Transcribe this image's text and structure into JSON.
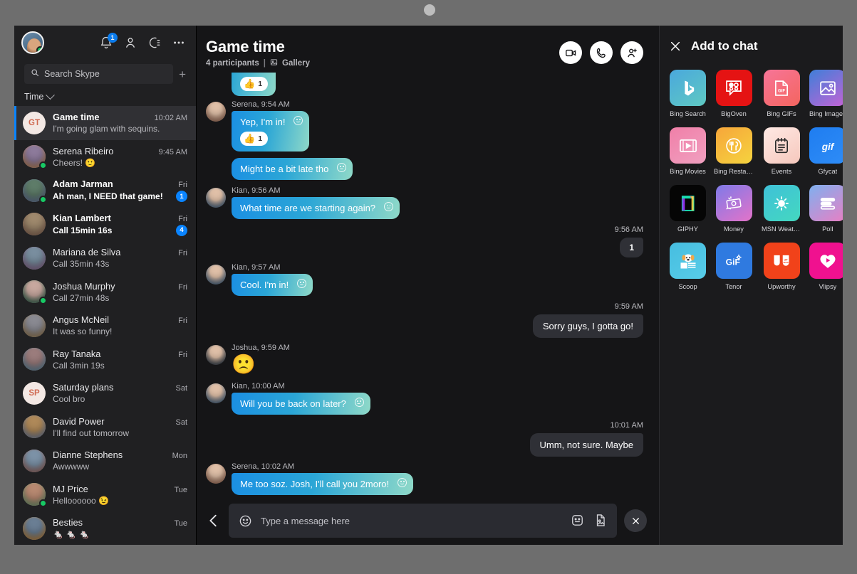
{
  "window": {
    "notch": "camera-dot"
  },
  "sidebar": {
    "profile": {
      "name": "my-avatar",
      "status": "online"
    },
    "header_icons": [
      {
        "name": "notifications-bell-icon",
        "badge": "1"
      },
      {
        "name": "contacts-person-icon",
        "badge": ""
      },
      {
        "name": "status-moon-icon",
        "badge": ""
      },
      {
        "name": "more-options-icon",
        "badge": ""
      }
    ],
    "search": {
      "placeholder": "Search Skype",
      "value": "",
      "new_chat": "+"
    },
    "filter": {
      "label": "Time"
    },
    "chats": [
      {
        "name": "Game time",
        "preview": "I'm going glam with sequins.",
        "time": "10:02 AM",
        "badge": "",
        "initials": "GT",
        "active": true,
        "bold_name": true,
        "presence": false
      },
      {
        "name": "Serena Ribeiro",
        "preview": "Cheers! 🙂",
        "time": "9:45 AM",
        "badge": "",
        "initials": "",
        "active": false,
        "bold_name": false,
        "presence": true
      },
      {
        "name": "Adam Jarman",
        "preview": "Ah man, I NEED that game!",
        "time": "Fri",
        "badge": "1",
        "initials": "",
        "active": false,
        "bold_name": true,
        "presence": true
      },
      {
        "name": "Kian Lambert",
        "preview": "Call 15min 16s",
        "time": "Fri",
        "badge": "4",
        "initials": "",
        "active": false,
        "bold_name": true,
        "presence": false
      },
      {
        "name": "Mariana de Silva",
        "preview": "Call 35min 43s",
        "time": "Fri",
        "badge": "",
        "initials": "",
        "active": false,
        "bold_name": false,
        "presence": false
      },
      {
        "name": "Joshua Murphy",
        "preview": "Call 27min 48s",
        "time": "Fri",
        "badge": "",
        "initials": "",
        "active": false,
        "bold_name": false,
        "presence": true
      },
      {
        "name": "Angus McNeil",
        "preview": "It was so funny!",
        "time": "Fri",
        "badge": "",
        "initials": "",
        "active": false,
        "bold_name": false,
        "presence": false
      },
      {
        "name": "Ray Tanaka",
        "preview": "Call 3min 19s",
        "time": "Fri",
        "badge": "",
        "initials": "",
        "active": false,
        "bold_name": false,
        "presence": false
      },
      {
        "name": "Saturday plans",
        "preview": "Cool bro",
        "time": "Sat",
        "badge": "",
        "initials": "SP",
        "active": false,
        "bold_name": false,
        "presence": false
      },
      {
        "name": "David Power",
        "preview": "I'll find out tomorrow",
        "time": "Sat",
        "badge": "",
        "initials": "",
        "active": false,
        "bold_name": false,
        "presence": false
      },
      {
        "name": "Dianne Stephens",
        "preview": "Awwwww",
        "time": "Mon",
        "badge": "",
        "initials": "",
        "active": false,
        "bold_name": false,
        "presence": false
      },
      {
        "name": "MJ Price",
        "preview": "Helloooooo 😉",
        "time": "Tue",
        "badge": "",
        "initials": "",
        "active": false,
        "bold_name": false,
        "presence": true
      },
      {
        "name": "Besties",
        "preview": "🐁 🐁 🐁",
        "time": "Tue",
        "badge": "",
        "initials": "",
        "active": false,
        "bold_name": false,
        "presence": false
      }
    ]
  },
  "chat": {
    "title": "Game time",
    "participants": "4 participants",
    "separator": "|",
    "gallery": "Gallery",
    "actions": [
      {
        "name": "video-call-button"
      },
      {
        "name": "audio-call-button"
      },
      {
        "name": "add-people-button"
      }
    ],
    "messages": [
      {
        "id": "m0",
        "type": "partial-top",
        "reaction_emoji": "👍",
        "reaction_count": "1"
      },
      {
        "id": "m1",
        "type": "in",
        "meta": "Serena, 9:54 AM",
        "text": "Yep, I'm in!",
        "reaction_emoji": "👍",
        "reaction_count": "1"
      },
      {
        "id": "m2",
        "type": "in-cont",
        "meta": "",
        "text": "Might be a bit late tho",
        "reaction_emoji": "",
        "reaction_count": ""
      },
      {
        "id": "m3",
        "type": "in",
        "meta": "Kian, 9:56 AM",
        "text": "What time are we starting again?",
        "reaction_emoji": "",
        "reaction_count": ""
      },
      {
        "id": "m4",
        "type": "out",
        "time": "9:56 AM",
        "text": "1"
      },
      {
        "id": "m5",
        "type": "in",
        "meta": "Kian, 9:57 AM",
        "text": "Cool. I'm in!",
        "reaction_emoji": "",
        "reaction_count": ""
      },
      {
        "id": "m6",
        "type": "out",
        "time": "9:59 AM",
        "text": "Sorry guys, I gotta go!"
      },
      {
        "id": "m7",
        "type": "in-emoji",
        "meta": "Joshua, 9:59 AM",
        "text": "🙁"
      },
      {
        "id": "m8",
        "type": "in",
        "meta": "Kian, 10:00 AM",
        "text": "Will you be back on later?",
        "reaction_emoji": "",
        "reaction_count": ""
      },
      {
        "id": "m9",
        "type": "out",
        "time": "10:01 AM",
        "text": "Umm, not sure. Maybe"
      },
      {
        "id": "m10",
        "type": "in",
        "meta": "Serena, 10:02 AM",
        "text": "Me too soz. Josh, I'll call you 2moro!",
        "reaction_emoji": "",
        "reaction_count": ""
      }
    ],
    "composer": {
      "back": "back-chevron",
      "emoji": "emoji-icon",
      "placeholder": "Type a message here",
      "value": "",
      "sticker": "sticker-icon",
      "image": "image-attachment-icon",
      "close": "close-panel-button"
    }
  },
  "add_panel": {
    "close": "×",
    "title": "Add to chat",
    "apps": [
      {
        "label": "Bing Search",
        "icon": "bing-logo-icon"
      },
      {
        "label": "BigOven",
        "icon": "bigoven-icon"
      },
      {
        "label": "Bing GIFs",
        "icon": "gif-file-icon"
      },
      {
        "label": "Bing Images",
        "icon": "image-icon"
      },
      {
        "label": "Bing Movies",
        "icon": "film-play-icon"
      },
      {
        "label": "Bing Restaur...",
        "icon": "cutlery-icon"
      },
      {
        "label": "Events",
        "icon": "calendar-notes-icon"
      },
      {
        "label": "Gfycat",
        "icon": "gif-text-icon"
      },
      {
        "label": "GIPHY",
        "icon": "giphy-icon"
      },
      {
        "label": "Money",
        "icon": "banknote-icon"
      },
      {
        "label": "MSN Weather",
        "icon": "sun-icon"
      },
      {
        "label": "Poll",
        "icon": "poll-bars-icon"
      },
      {
        "label": "Scoop",
        "icon": "dog-news-icon"
      },
      {
        "label": "Tenor",
        "icon": "gif-tenor-icon"
      },
      {
        "label": "Upworthy",
        "icon": "upworthy-icon"
      },
      {
        "label": "Vlipsy",
        "icon": "play-heart-icon"
      }
    ]
  },
  "colors": {
    "accent": "#0a84ff",
    "presence_online": "#17c964",
    "bubble_in_from": "#1b8fe3",
    "bubble_in_to": "#8fd9c8",
    "bubble_out": "#2f3036"
  }
}
